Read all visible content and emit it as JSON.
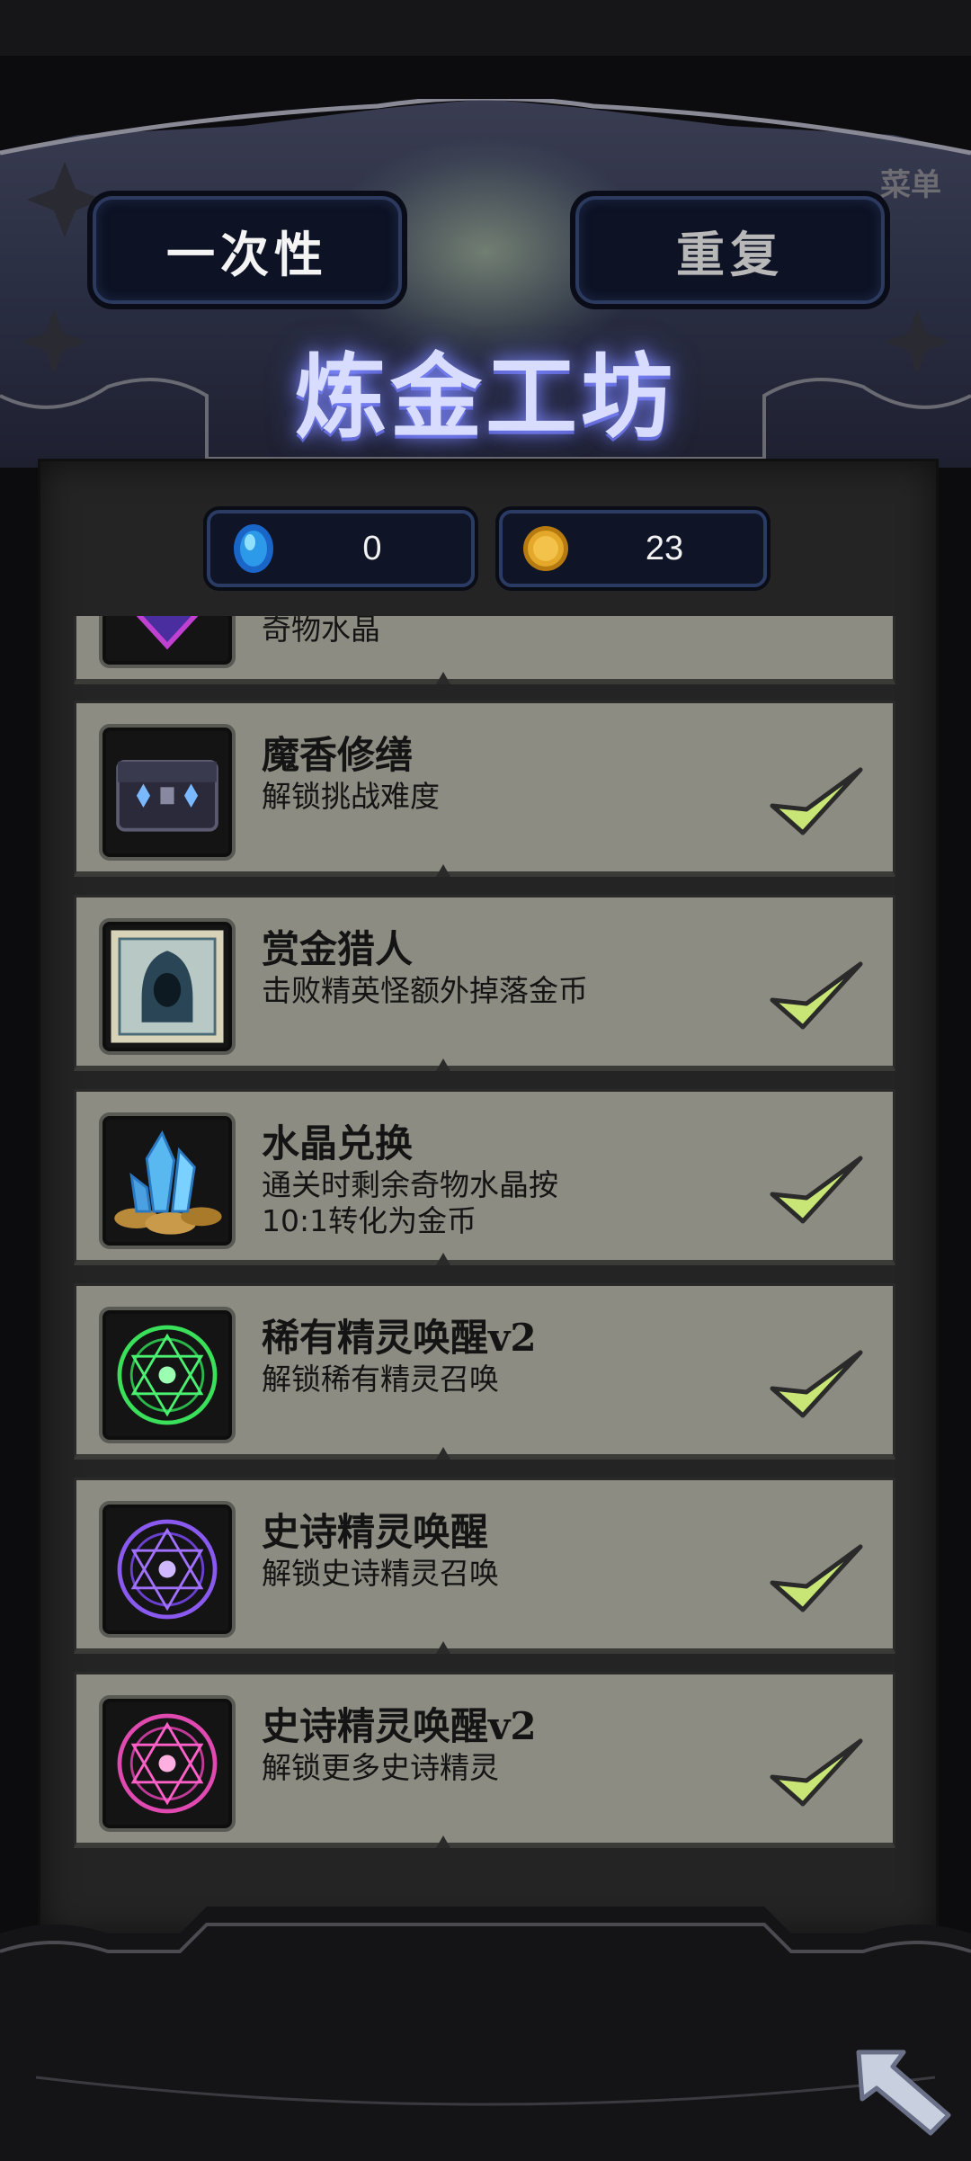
{
  "tabs": {
    "once": "一次性",
    "repeat": "重复"
  },
  "menu_label": "菜单",
  "title": "炼金工坊",
  "currency": {
    "gems": "0",
    "gold": "23"
  },
  "upgrades": [
    {
      "title": "",
      "desc": "奇物水晶",
      "icon": "crystal-heart-icon",
      "completed": true
    },
    {
      "title": "魔香修缮",
      "desc": "解锁挑战难度",
      "icon": "treasure-chest-icon",
      "completed": true
    },
    {
      "title": "赏金猎人",
      "desc": "击败精英怪额外掉落金币",
      "icon": "hooded-hunter-scroll-icon",
      "completed": true
    },
    {
      "title": "水晶兑换",
      "desc": "通关时剩余奇物水晶按10:1转化为金币",
      "icon": "crystal-coins-icon",
      "completed": true
    },
    {
      "title": "稀有精灵唤醒v2",
      "desc": "解锁稀有精灵召唤",
      "icon": "green-magic-circle-icon",
      "completed": true
    },
    {
      "title": "史诗精灵唤醒",
      "desc": "解锁史诗精灵召唤",
      "icon": "purple-magic-circle-icon",
      "completed": true
    },
    {
      "title": "史诗精灵唤醒v2",
      "desc": "解锁更多史诗精灵",
      "icon": "pink-magic-circle-icon",
      "completed": true
    }
  ],
  "colors": {
    "card_bg": "#8c8c82",
    "check": "#c8e676",
    "title_glow": "#8c96ff"
  }
}
